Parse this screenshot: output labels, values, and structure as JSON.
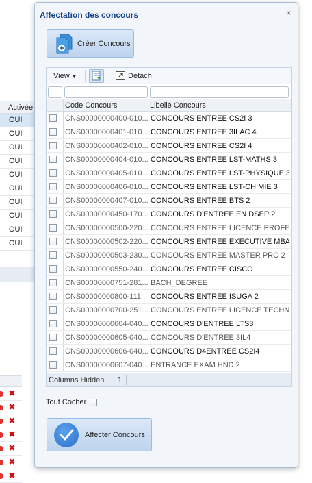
{
  "background": {
    "column_header": "Activée",
    "rows": [
      "OUI",
      "OUI",
      "OUI",
      "OUI",
      "OUI",
      "OUI",
      "OUI",
      "OUI",
      "OUI",
      "OUI"
    ]
  },
  "dialog": {
    "title": "Affectation des concours",
    "close_glyph": "×",
    "create_button_label": "Créer Concours",
    "toolbar": {
      "view_label": "View",
      "detach_label": "Detach"
    },
    "columns": {
      "code": "Code Concours",
      "libelle": "Libellé Concours"
    },
    "rows": [
      {
        "code": "CNS00000000400-010...",
        "libelle": "CONCOURS ENTREE CS2I 3",
        "bold": true
      },
      {
        "code": "CNS00000000401-010...",
        "libelle": "CONCOURS ENTREE 3ILAC 4",
        "bold": true
      },
      {
        "code": "CNS00000000402-010...",
        "libelle": "CONCOURS ENTREE CS2I 4",
        "bold": true
      },
      {
        "code": "CNS00000000404-010...",
        "libelle": "CONCOURS ENTREE LST-MATHS 3",
        "bold": true
      },
      {
        "code": "CNS00000000405-010...",
        "libelle": "CONCOURS ENTREE LST-PHYSIQUE 3",
        "bold": true
      },
      {
        "code": "CNS00000000406-010...",
        "libelle": "CONCOURS ENTREE LST-CHIMIE 3",
        "bold": true
      },
      {
        "code": "CNS00000000407-010...",
        "libelle": "CONCOURS ENTREE BTS 2",
        "bold": true
      },
      {
        "code": "CNS00000000450-170...",
        "libelle": "CONCOURS D'ENTREE EN DSEP 2",
        "bold": true
      },
      {
        "code": "CNS00000000500-220...",
        "libelle": "CONCOURS ENTREE LICENCE PROFESS...",
        "bold": false
      },
      {
        "code": "CNS00000000502-220...",
        "libelle": "CONCOURS ENTREE EXECUTIVE MBA",
        "bold": true
      },
      {
        "code": "CNS00000000503-230...",
        "libelle": "CONCOURS ENTREE MASTER PRO 2",
        "bold": false
      },
      {
        "code": "CNS00000000550-240...",
        "libelle": "CONCOURS ENTREE CISCO",
        "bold": true
      },
      {
        "code": "CNS00000000751-281...",
        "libelle": "BACH_DEGREE",
        "bold": false
      },
      {
        "code": "CNS00000000800-111...",
        "libelle": "CONCOURS ENTREE ISUGA 2",
        "bold": true
      },
      {
        "code": "CNS00000000700-251...",
        "libelle": "CONCOURS ENTREE LICENCE TECHNO...",
        "bold": false
      },
      {
        "code": "CNS00000000604-040...",
        "libelle": "CONCOURS D'ENTREE LTS3",
        "bold": true
      },
      {
        "code": "CNS00000000605-040...",
        "libelle": "CONCOURS D'ENTREE 3IL4",
        "bold": false
      },
      {
        "code": "CNS00000000606-040...",
        "libelle": "CONCOURS D4ENTREE CS2I4",
        "bold": true
      },
      {
        "code": "CNS00000000607-040...",
        "libelle": "ENTRANCE EXAM HND 2",
        "bold": false
      }
    ],
    "status": {
      "label": "Columns Hidden",
      "count": "1"
    },
    "select_all_label": "Tout Cocher",
    "affect_button_label": "Affecter Concours"
  }
}
